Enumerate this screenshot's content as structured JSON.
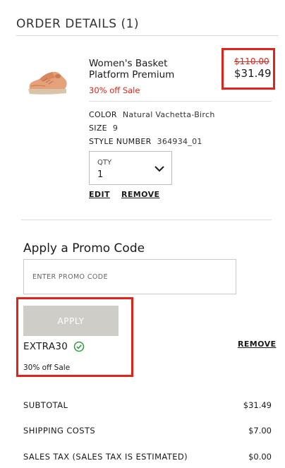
{
  "header": {
    "title": "ORDER DETAILS (1)"
  },
  "item": {
    "name": "Women's Basket Platform Premium",
    "sale_label": "30% off Sale",
    "original_price": "$110.00",
    "price": "$31.49",
    "attributes": {
      "color_label": "COLOR",
      "color_value": "Natural Vachetta-Birch",
      "size_label": "SIZE",
      "size_value": "9",
      "style_label": "STYLE NUMBER",
      "style_value": "364934_01"
    },
    "qty_label": "QTY",
    "qty_value": "1",
    "edit_label": "EDIT",
    "remove_label": "REMOVE"
  },
  "promo": {
    "heading": "Apply a Promo Code",
    "placeholder": "ENTER PROMO CODE",
    "apply_label": "APPLY",
    "applied_code": "EXTRA30",
    "applied_desc": "30% off Sale",
    "remove_label": "REMOVE"
  },
  "summary": [
    {
      "label": "SUBTOTAL",
      "value": "$31.49"
    },
    {
      "label": "SHIPPING COSTS",
      "value": "$7.00"
    },
    {
      "label": "SALES TAX (SALES TAX IS ESTIMATED)",
      "value": "$0.00"
    }
  ],
  "colors": {
    "accent_red": "#e2231a",
    "apply_button": "#cfcdc8",
    "valid_green": "#2e9e3e"
  },
  "icons": {
    "qty_chevron": "chevron-down-icon",
    "valid": "check-circle-icon"
  }
}
